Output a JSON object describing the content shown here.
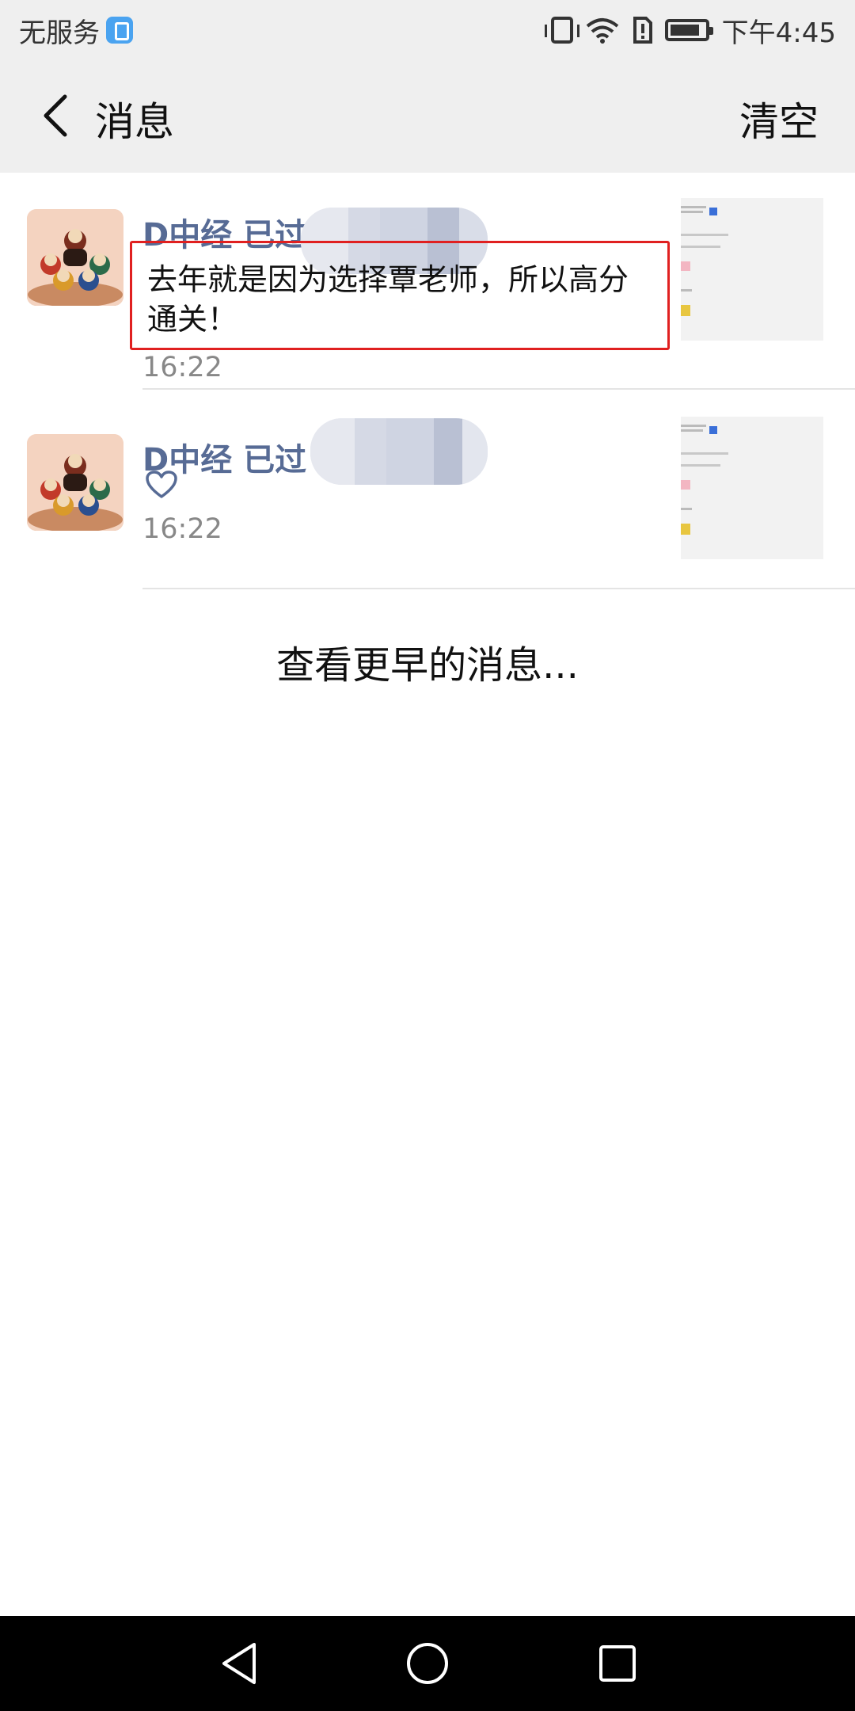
{
  "status_bar": {
    "carrier": "无服务",
    "time": "下午4:45",
    "icons": [
      "app-badge-icon",
      "vibrate-icon",
      "wifi-icon",
      "alert-icon",
      "battery-icon"
    ]
  },
  "header": {
    "title": "消息",
    "clear_label": "清空",
    "back_icon": "chevron-left-icon"
  },
  "messages": [
    {
      "sender": "D中经 已过",
      "content": "去年就是因为选择覃老师，所以高分通关！",
      "time": "16:22",
      "highlighted": true
    },
    {
      "sender": "D中经 已过",
      "content_icon": "heart-icon",
      "time": "16:22",
      "highlighted": false
    }
  ],
  "load_more": "查看更早的消息...",
  "nav_bar": {
    "icons": [
      "back-triangle-icon",
      "home-circle-icon",
      "recents-square-icon"
    ]
  },
  "colors": {
    "sender": "#576b95",
    "highlight_border": "#e02020",
    "header_bg": "#efefef",
    "nav_bg": "#000000"
  }
}
